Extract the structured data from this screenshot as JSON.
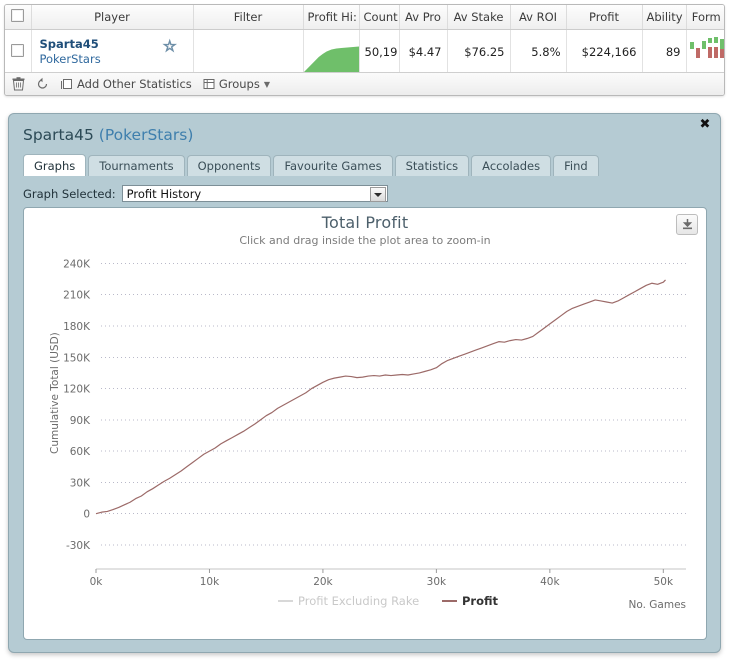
{
  "grid": {
    "columns": [
      {
        "key": "checkbox",
        "label": ""
      },
      {
        "key": "player",
        "label": "Player"
      },
      {
        "key": "filter",
        "label": "Filter"
      },
      {
        "key": "profit_history",
        "label": "Profit Hi:"
      },
      {
        "key": "count",
        "label": "Count"
      },
      {
        "key": "av_profit",
        "label": "Av Pro"
      },
      {
        "key": "av_stake",
        "label": "Av Stake"
      },
      {
        "key": "av_roi",
        "label": "Av ROI"
      },
      {
        "key": "profit",
        "label": "Profit"
      },
      {
        "key": "ability",
        "label": "Ability"
      },
      {
        "key": "form",
        "label": "Form"
      }
    ],
    "rows": [
      {
        "player_name": "Sparta45",
        "player_site": "PokerStars",
        "filter": "",
        "count": "50,19",
        "av_profit": "$4.47",
        "av_stake": "$76.25",
        "av_roi": "5.8%",
        "profit": "$224,166",
        "ability": "89",
        "favourite_star": "☆"
      }
    ],
    "toolbar": {
      "delete_label": "",
      "refresh_label": "",
      "add_stats_label": "Add Other Statistics",
      "groups_label": "Groups",
      "groups_caret": "▼"
    }
  },
  "window": {
    "title_player": "Sparta45",
    "title_site": "(PokerStars)",
    "close_glyph": "✖",
    "tabs": [
      {
        "label": "Graphs",
        "active": true
      },
      {
        "label": "Tournaments",
        "active": false
      },
      {
        "label": "Opponents",
        "active": false
      },
      {
        "label": "Favourite Games",
        "active": false
      },
      {
        "label": "Statistics",
        "active": false
      },
      {
        "label": "Accolades",
        "active": false
      },
      {
        "label": "Find",
        "active": false
      }
    ],
    "graph_selector": {
      "label": "Graph Selected:",
      "value": "Profit History",
      "options": [
        "Profit History"
      ]
    },
    "download_tooltip": "Download"
  },
  "chart_data": {
    "type": "line",
    "title": "Total Profit",
    "subtitle": "Click and drag inside the plot area to zoom-in",
    "xlabel": "No. Games",
    "ylabel": "Cumulative Total (USD)",
    "xlim": [
      0,
      52000
    ],
    "ylim": [
      -30000,
      250000
    ],
    "grid": true,
    "legend_position": "bottom-center",
    "xticks": [
      0,
      10000,
      20000,
      30000,
      40000,
      50000
    ],
    "xticklabels": [
      "0k",
      "10k",
      "20k",
      "30k",
      "40k",
      "50k"
    ],
    "yticks": [
      -30000,
      0,
      30000,
      60000,
      90000,
      120000,
      150000,
      180000,
      210000,
      240000
    ],
    "yticklabels": [
      "-30K",
      "0",
      "30K",
      "60K",
      "90K",
      "120K",
      "150K",
      "180K",
      "210K",
      "240K"
    ],
    "series": [
      {
        "name": "Profit Excluding Rake",
        "color": "#d8d8d8",
        "active": false,
        "x": [],
        "values": []
      },
      {
        "name": "Profit",
        "color": "#9c6a68",
        "active": true,
        "x": [
          0,
          500,
          1000,
          1500,
          2000,
          2500,
          3000,
          3500,
          4000,
          4500,
          5000,
          5500,
          6000,
          6500,
          7000,
          7500,
          8000,
          8500,
          9000,
          9500,
          10000,
          10500,
          11000,
          11500,
          12000,
          12500,
          13000,
          13500,
          14000,
          14500,
          15000,
          15500,
          16000,
          16500,
          17000,
          17500,
          18000,
          18500,
          19000,
          19500,
          20000,
          20500,
          21000,
          21500,
          22000,
          22500,
          23000,
          23500,
          24000,
          24500,
          25000,
          25500,
          26000,
          26500,
          27000,
          27500,
          28000,
          28500,
          29000,
          29500,
          30000,
          30500,
          31000,
          31500,
          32000,
          32500,
          33000,
          33500,
          34000,
          34500,
          35000,
          35500,
          36000,
          36500,
          37000,
          37500,
          38000,
          38500,
          39000,
          39500,
          40000,
          40500,
          41000,
          41500,
          42000,
          42500,
          43000,
          43500,
          44000,
          44500,
          45000,
          45500,
          46000,
          46500,
          47000,
          47500,
          48000,
          48500,
          49000,
          49500,
          50000,
          50195
        ],
        "values": [
          0,
          1500,
          2200,
          4000,
          6000,
          8500,
          11000,
          14500,
          17000,
          21000,
          24000,
          27500,
          31000,
          34000,
          37500,
          41000,
          45000,
          49000,
          53000,
          57000,
          60000,
          63000,
          67000,
          70000,
          73000,
          76000,
          79000,
          82500,
          86000,
          90000,
          94000,
          97000,
          101000,
          104000,
          107000,
          110000,
          113000,
          116000,
          120000,
          123000,
          126000,
          128500,
          130000,
          131000,
          132000,
          131500,
          130500,
          131000,
          132000,
          132500,
          132000,
          133000,
          132500,
          133000,
          133500,
          133000,
          134000,
          135000,
          136500,
          138000,
          140000,
          144000,
          147000,
          149000,
          151000,
          153000,
          155000,
          157000,
          159000,
          161000,
          163000,
          165000,
          164500,
          166000,
          167000,
          166500,
          168000,
          170000,
          174000,
          178000,
          182000,
          186000,
          190000,
          194000,
          197000,
          199000,
          201000,
          203000,
          205000,
          204000,
          203000,
          202000,
          204000,
          207000,
          210000,
          213000,
          216000,
          219000,
          221000,
          220000,
          222000,
          224166
        ]
      }
    ]
  }
}
